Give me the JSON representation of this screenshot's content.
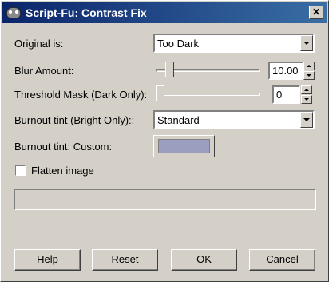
{
  "window": {
    "title": "Script-Fu: Contrast Fix",
    "close_glyph": "✕",
    "app_icon": "gimp-icon"
  },
  "fields": {
    "original_is": {
      "label": "Original is:",
      "value": "Too Dark"
    },
    "blur_amount": {
      "label": "Blur Amount:",
      "value": "10.00",
      "slider_fraction": 0.1
    },
    "threshold_mask": {
      "label": "Threshold Mask (Dark Only):",
      "value": "0",
      "slider_fraction": 0.0
    },
    "burnout_tint": {
      "label": "Burnout tint (Bright Only)::",
      "value": "Standard"
    },
    "burnout_tint_custom": {
      "label": "Burnout tint: Custom:",
      "color": "#9a9fc0"
    },
    "flatten_image": {
      "label": "Flatten image",
      "checked": false
    }
  },
  "buttons": {
    "help": {
      "mnemonic": "H",
      "rest": "elp"
    },
    "reset": {
      "mnemonic": "R",
      "rest": "eset"
    },
    "ok": {
      "mnemonic": "O",
      "rest": "K"
    },
    "cancel": {
      "mnemonic": "C",
      "rest": "ancel"
    }
  },
  "colors": {
    "titlebar_start": "#0a246a",
    "titlebar_end": "#3a6ea5",
    "face": "#d4d0c8"
  }
}
